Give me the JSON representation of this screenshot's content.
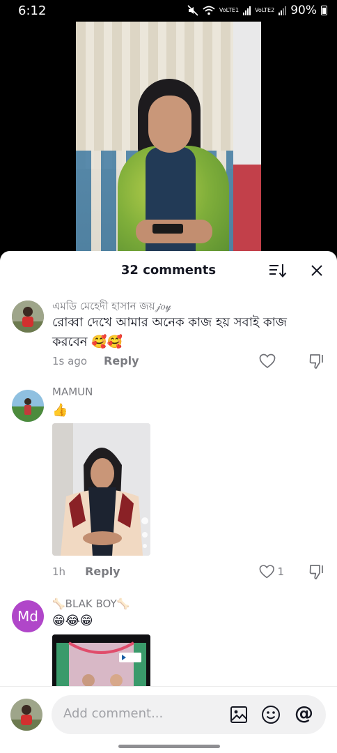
{
  "status_bar": {
    "time": "6:12",
    "sim1": "VoLTE1",
    "sim2": "VoLTE2",
    "battery": "90%"
  },
  "sheet": {
    "title": "32 comments",
    "icons": {
      "sort": "sort-icon",
      "close": "close-icon"
    }
  },
  "comments": [
    {
      "username": "এমডি মেহেদী হাসান জয়𝒿𝑜𝓎",
      "text": "রোব্বা দেখে আমার অনেক কাজ হয় সবাই কাজ করবেন 🥰🥰",
      "time": "1s ago",
      "reply": "Reply",
      "likes": ""
    },
    {
      "username": "MAMUN",
      "text": "👍",
      "time": "1h",
      "reply": "Reply",
      "likes": "1"
    },
    {
      "username": "🦴BLAK BOY🦴",
      "avatar_letters": "Md",
      "text": "😁😂😁"
    }
  ],
  "composer": {
    "placeholder": "Add comment...",
    "icons": {
      "image": "image-icon",
      "emoji": "emoji-icon",
      "mention": "at-icon"
    },
    "mention_symbol": "@"
  },
  "colors": {
    "sheet_bg": "#ffffff",
    "text": "#161823",
    "muted": "#7a7b80",
    "md_avatar": "#b046c9"
  }
}
